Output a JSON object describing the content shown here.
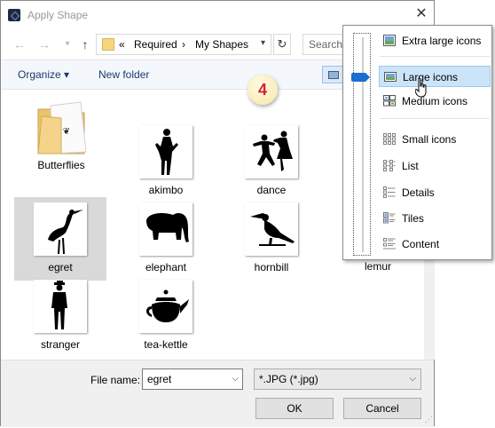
{
  "window": {
    "title": "Apply Shape",
    "close_glyph": "✕"
  },
  "nav": {
    "back_glyph": "←",
    "forward_glyph": "→",
    "up_glyph": "↑",
    "breadcrumb_prefix": "«",
    "breadcrumbs": [
      "Required",
      "My Shapes"
    ],
    "separator": "›",
    "search_placeholder": "Search"
  },
  "toolbar": {
    "organize_label": "Organize ▾",
    "new_folder_label": "New folder"
  },
  "badge": "4",
  "files": [
    {
      "name": "Butterflies",
      "kind": "folder"
    },
    {
      "name": "akimbo",
      "kind": "image"
    },
    {
      "name": "dance",
      "kind": "image"
    },
    {
      "name": "lemur",
      "kind": "image"
    },
    {
      "name": "egret",
      "kind": "image",
      "selected": true
    },
    {
      "name": "elephant",
      "kind": "image"
    },
    {
      "name": "hornbill",
      "kind": "image"
    },
    {
      "name": "stranger",
      "kind": "image"
    },
    {
      "name": "tea-kettle",
      "kind": "image"
    }
  ],
  "bottom": {
    "file_name_label": "File name:",
    "file_name_value": "egret",
    "file_type_value": "*.JPG (*.jpg)",
    "ok_label": "OK",
    "cancel_label": "Cancel"
  },
  "view_menu": {
    "selected": "Large icons",
    "items": [
      {
        "label": "Extra large icons",
        "icon": "extra-large-icons-icon"
      },
      {
        "label": "Large icons",
        "icon": "large-icons-icon"
      },
      {
        "label": "Medium icons",
        "icon": "medium-icons-icon"
      },
      {
        "label": "Small icons",
        "icon": "small-icons-icon"
      },
      {
        "label": "List",
        "icon": "list-icon"
      },
      {
        "label": "Details",
        "icon": "details-icon"
      },
      {
        "label": "Tiles",
        "icon": "tiles-icon"
      },
      {
        "label": "Content",
        "icon": "content-icon"
      }
    ]
  },
  "colors": {
    "accent": "#1b6fd0",
    "badge_text": "#d3202f",
    "selection": "#d9d9d9",
    "menu_highlight": "#cce4f7"
  }
}
